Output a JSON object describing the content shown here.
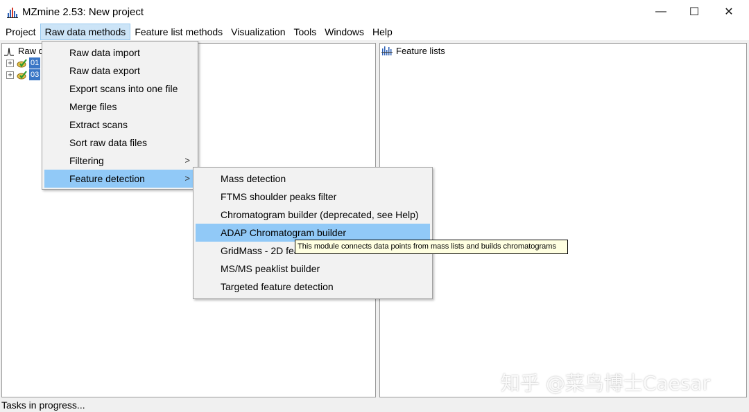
{
  "window": {
    "title": "MZmine 2.53: New project",
    "controls": {
      "minimize": "—",
      "maximize": "☐",
      "close": "✕"
    }
  },
  "menubar": {
    "items": [
      {
        "label": "Project"
      },
      {
        "label": "Raw data methods"
      },
      {
        "label": "Feature list methods"
      },
      {
        "label": "Visualization"
      },
      {
        "label": "Tools"
      },
      {
        "label": "Windows"
      },
      {
        "label": "Help"
      }
    ]
  },
  "raw_data_menu": {
    "items": [
      {
        "label": "Raw data import"
      },
      {
        "label": "Raw data export"
      },
      {
        "label": "Export scans into one file"
      },
      {
        "label": "Merge files"
      },
      {
        "label": "Extract scans"
      },
      {
        "label": "Sort raw data files"
      },
      {
        "label": "Filtering",
        "arrow": ">"
      },
      {
        "label": "Feature detection",
        "arrow": ">"
      }
    ]
  },
  "feature_detection_menu": {
    "items": [
      {
        "label": "Mass detection"
      },
      {
        "label": "FTMS shoulder peaks filter"
      },
      {
        "label": "Chromatogram builder (deprecated, see Help)"
      },
      {
        "label": "ADAP Chromatogram builder"
      },
      {
        "label": "GridMass - 2D feature detection"
      },
      {
        "label": "MS/MS peaklist builder"
      },
      {
        "label": "Targeted feature detection"
      }
    ]
  },
  "tooltip": {
    "text": "This module connects data points from mass lists and builds chromatograms"
  },
  "raw_panel": {
    "header": "Raw data files",
    "files": [
      {
        "label": "01",
        "expander": "+"
      },
      {
        "label": "03",
        "expander": "+"
      }
    ]
  },
  "feature_panel": {
    "header": "Feature lists"
  },
  "status": {
    "text": "Tasks in progress..."
  },
  "watermark": {
    "text": "知乎 @菜鸟博士Caesar"
  },
  "colors": {
    "menu_highlight": "#91c9f7",
    "menubar_active": "#cce4f7",
    "selection": "#3a76c6",
    "tooltip_bg": "#ffffe1"
  }
}
